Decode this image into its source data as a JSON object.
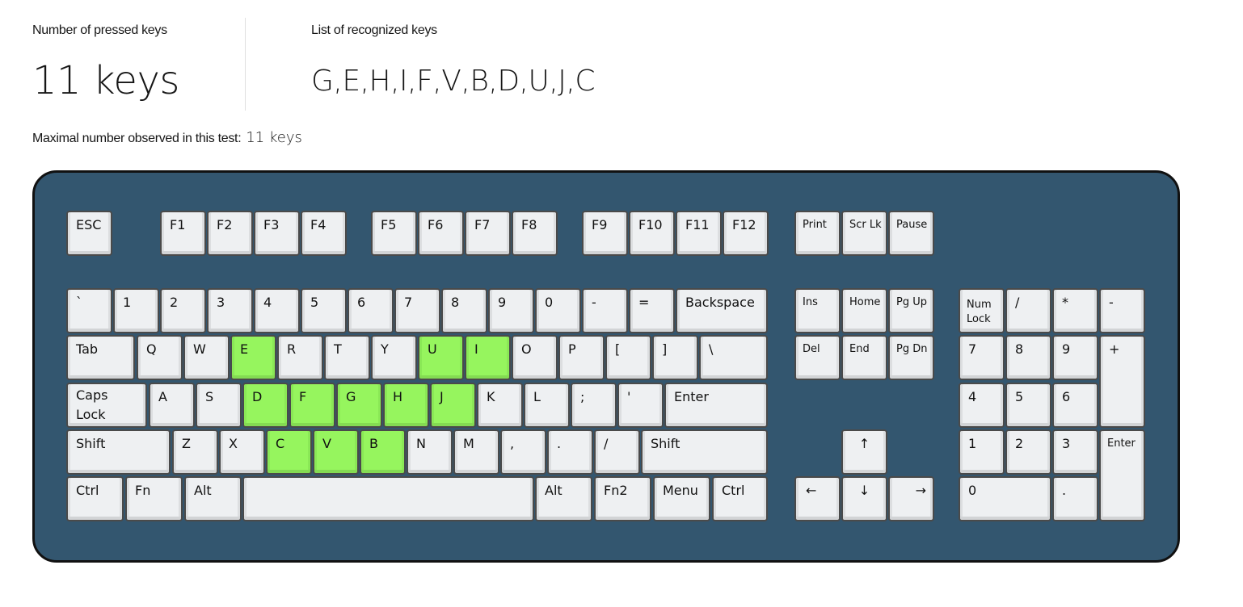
{
  "stats": {
    "pressed_label": "Number of pressed keys",
    "pressed_value": "11 keys",
    "recognized_label": "List of recognized keys",
    "recognized_value": "G,E,H,I,F,V,B,D,U,J,C",
    "max_label": "Maximal number observed in this test:",
    "max_value": "11 keys"
  },
  "colors": {
    "keyboard_bg": "#33566f",
    "key_idle": "#eef0f2",
    "key_pressed": "#96f55e"
  },
  "pressed_keys": [
    "G",
    "E",
    "H",
    "I",
    "F",
    "V",
    "B",
    "D",
    "U",
    "J",
    "C"
  ],
  "keys": [
    {
      "id": "esc",
      "label": "ESC"
    },
    {
      "id": "f1",
      "label": "F1"
    },
    {
      "id": "f2",
      "label": "F2"
    },
    {
      "id": "f3",
      "label": "F3"
    },
    {
      "id": "f4",
      "label": "F4"
    },
    {
      "id": "f5",
      "label": "F5"
    },
    {
      "id": "f6",
      "label": "F6"
    },
    {
      "id": "f7",
      "label": "F7"
    },
    {
      "id": "f8",
      "label": "F8"
    },
    {
      "id": "f9",
      "label": "F9"
    },
    {
      "id": "f10",
      "label": "F10"
    },
    {
      "id": "f11",
      "label": "F11"
    },
    {
      "id": "f12",
      "label": "F12"
    },
    {
      "id": "print",
      "label": "Print"
    },
    {
      "id": "scrlk",
      "label": "Scr Lk"
    },
    {
      "id": "pause",
      "label": "Pause"
    },
    {
      "id": "backtick",
      "label": "`"
    },
    {
      "id": "d1",
      "label": "1"
    },
    {
      "id": "d2",
      "label": "2"
    },
    {
      "id": "d3",
      "label": "3"
    },
    {
      "id": "d4",
      "label": "4"
    },
    {
      "id": "d5",
      "label": "5"
    },
    {
      "id": "d6",
      "label": "6"
    },
    {
      "id": "d7",
      "label": "7"
    },
    {
      "id": "d8",
      "label": "8"
    },
    {
      "id": "d9",
      "label": "9"
    },
    {
      "id": "d0",
      "label": "0"
    },
    {
      "id": "minus",
      "label": "-"
    },
    {
      "id": "equal",
      "label": "="
    },
    {
      "id": "backspace",
      "label": "Backspace"
    },
    {
      "id": "tab",
      "label": "Tab"
    },
    {
      "id": "q",
      "label": "Q"
    },
    {
      "id": "w",
      "label": "W"
    },
    {
      "id": "e",
      "label": "E",
      "pressed": true
    },
    {
      "id": "r",
      "label": "R"
    },
    {
      "id": "t",
      "label": "T"
    },
    {
      "id": "y",
      "label": "Y"
    },
    {
      "id": "u",
      "label": "U",
      "pressed": true
    },
    {
      "id": "i",
      "label": "I",
      "pressed": true
    },
    {
      "id": "o",
      "label": "O"
    },
    {
      "id": "p",
      "label": "P"
    },
    {
      "id": "lbracket",
      "label": "["
    },
    {
      "id": "rbracket",
      "label": "]"
    },
    {
      "id": "backslash",
      "label": "\\"
    },
    {
      "id": "caps",
      "label": "Caps",
      "label2": "Lock"
    },
    {
      "id": "a",
      "label": "A"
    },
    {
      "id": "s",
      "label": "S"
    },
    {
      "id": "d",
      "label": "D",
      "pressed": true
    },
    {
      "id": "f",
      "label": "F",
      "pressed": true
    },
    {
      "id": "g",
      "label": "G",
      "pressed": true
    },
    {
      "id": "h",
      "label": "H",
      "pressed": true
    },
    {
      "id": "j",
      "label": "J",
      "pressed": true
    },
    {
      "id": "k",
      "label": "K"
    },
    {
      "id": "l",
      "label": "L"
    },
    {
      "id": "semicolon",
      "label": ";"
    },
    {
      "id": "quote",
      "label": "'"
    },
    {
      "id": "enter",
      "label": "Enter"
    },
    {
      "id": "lshift",
      "label": "Shift"
    },
    {
      "id": "z",
      "label": "Z"
    },
    {
      "id": "x",
      "label": "X"
    },
    {
      "id": "c",
      "label": "C",
      "pressed": true
    },
    {
      "id": "v",
      "label": "V",
      "pressed": true
    },
    {
      "id": "b",
      "label": "B",
      "pressed": true
    },
    {
      "id": "n",
      "label": "N"
    },
    {
      "id": "m",
      "label": "M"
    },
    {
      "id": "comma",
      "label": ","
    },
    {
      "id": "period",
      "label": "."
    },
    {
      "id": "slash",
      "label": "/"
    },
    {
      "id": "rshift",
      "label": "Shift"
    },
    {
      "id": "lctrl",
      "label": "Ctrl"
    },
    {
      "id": "fn",
      "label": "Fn"
    },
    {
      "id": "lalt",
      "label": "Alt"
    },
    {
      "id": "space",
      "label": ""
    },
    {
      "id": "ralt",
      "label": "Alt"
    },
    {
      "id": "fn2",
      "label": "Fn2"
    },
    {
      "id": "menu",
      "label": "Menu"
    },
    {
      "id": "rctrl",
      "label": "Ctrl"
    },
    {
      "id": "ins",
      "label": "Ins"
    },
    {
      "id": "home",
      "label": "Home"
    },
    {
      "id": "pgup",
      "label": "Pg Up"
    },
    {
      "id": "del",
      "label": "Del"
    },
    {
      "id": "end",
      "label": "End"
    },
    {
      "id": "pgdn",
      "label": "Pg Dn"
    },
    {
      "id": "up",
      "label": "↑"
    },
    {
      "id": "left",
      "label": "←"
    },
    {
      "id": "down",
      "label": "↓"
    },
    {
      "id": "right",
      "label": "→"
    },
    {
      "id": "numlock",
      "label": "Num",
      "label2": "Lock"
    },
    {
      "id": "npdiv",
      "label": "/"
    },
    {
      "id": "npmul",
      "label": "*"
    },
    {
      "id": "npsub",
      "label": "-"
    },
    {
      "id": "np7",
      "label": "7"
    },
    {
      "id": "np8",
      "label": "8"
    },
    {
      "id": "np9",
      "label": "9"
    },
    {
      "id": "npadd",
      "label": "+"
    },
    {
      "id": "np4",
      "label": "4"
    },
    {
      "id": "np5",
      "label": "5"
    },
    {
      "id": "np6",
      "label": "6"
    },
    {
      "id": "np1",
      "label": "1"
    },
    {
      "id": "np2",
      "label": "2"
    },
    {
      "id": "np3",
      "label": "3"
    },
    {
      "id": "npenter",
      "label": "Enter"
    },
    {
      "id": "np0",
      "label": "0"
    },
    {
      "id": "npdot",
      "label": "."
    }
  ]
}
